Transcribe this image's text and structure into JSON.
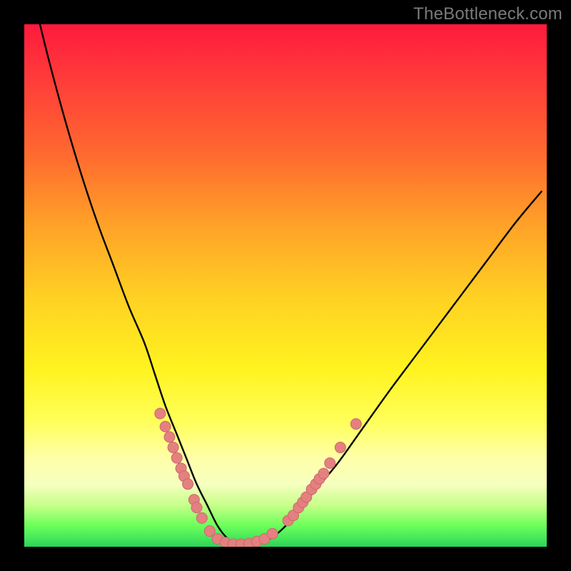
{
  "watermark": "TheBottleneck.com",
  "colors": {
    "background": "#000000",
    "curve_stroke": "#000000",
    "marker_fill": "#e58080",
    "marker_stroke": "#c96a6a"
  },
  "chart_data": {
    "type": "line",
    "title": "",
    "xlabel": "",
    "ylabel": "",
    "xlim": [
      0,
      100
    ],
    "ylim": [
      0,
      100
    ],
    "grid": false,
    "legend": false,
    "annotations": [
      "TheBottleneck.com"
    ],
    "series": [
      {
        "name": "bottleneck-curve",
        "x": [
          3,
          5,
          8,
          11,
          14,
          17,
          20,
          23,
          25,
          27,
          29,
          31,
          33,
          35,
          37,
          39,
          41,
          43,
          47,
          51,
          55,
          60,
          65,
          70,
          76,
          82,
          88,
          94,
          99
        ],
        "y": [
          100,
          92,
          81,
          71,
          62,
          54,
          46,
          39,
          33,
          27,
          22,
          17,
          12,
          8,
          4,
          1.5,
          0.5,
          0.5,
          1.5,
          5,
          10,
          16,
          23,
          30,
          38,
          46,
          54,
          62,
          68
        ]
      }
    ],
    "markers": [
      {
        "x": 26.0,
        "y": 25.5
      },
      {
        "x": 27.0,
        "y": 23.0
      },
      {
        "x": 27.8,
        "y": 21.0
      },
      {
        "x": 28.5,
        "y": 19.0
      },
      {
        "x": 29.2,
        "y": 17.0
      },
      {
        "x": 30.0,
        "y": 15.0
      },
      {
        "x": 30.6,
        "y": 13.5
      },
      {
        "x": 31.3,
        "y": 12.0
      },
      {
        "x": 32.5,
        "y": 9.0
      },
      {
        "x": 33.0,
        "y": 7.5
      },
      {
        "x": 34.0,
        "y": 5.5
      },
      {
        "x": 35.5,
        "y": 3.0
      },
      {
        "x": 37.0,
        "y": 1.5
      },
      {
        "x": 38.5,
        "y": 0.8
      },
      {
        "x": 40.0,
        "y": 0.5
      },
      {
        "x": 41.5,
        "y": 0.5
      },
      {
        "x": 43.0,
        "y": 0.6
      },
      {
        "x": 44.5,
        "y": 1.0
      },
      {
        "x": 46.0,
        "y": 1.5
      },
      {
        "x": 47.5,
        "y": 2.5
      },
      {
        "x": 50.5,
        "y": 5.0
      },
      {
        "x": 51.5,
        "y": 6.0
      },
      {
        "x": 52.5,
        "y": 7.5
      },
      {
        "x": 53.3,
        "y": 8.5
      },
      {
        "x": 54.0,
        "y": 9.5
      },
      {
        "x": 55.0,
        "y": 11.0
      },
      {
        "x": 55.8,
        "y": 12.0
      },
      {
        "x": 56.5,
        "y": 13.0
      },
      {
        "x": 57.3,
        "y": 14.0
      },
      {
        "x": 58.5,
        "y": 16.0
      },
      {
        "x": 60.5,
        "y": 19.0
      },
      {
        "x": 63.5,
        "y": 23.5
      }
    ]
  }
}
